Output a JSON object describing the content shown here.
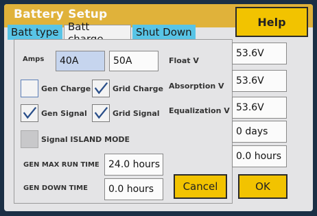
{
  "window": {
    "title": "Battery Setup",
    "help_label": "Help"
  },
  "tabs": [
    {
      "label": "Batt type",
      "active": false
    },
    {
      "label": "Batt charge",
      "active": true
    },
    {
      "label": "Shut Down",
      "active": false
    }
  ],
  "amps": {
    "label": "Amps",
    "options": [
      "40A",
      "50A"
    ],
    "selected": "40A"
  },
  "checkboxes": {
    "gen_charge": {
      "label": "Gen Charge",
      "checked": false
    },
    "grid_charge": {
      "label": "Grid Charge",
      "checked": true
    },
    "gen_signal": {
      "label": "Gen Signal",
      "checked": true
    },
    "grid_signal": {
      "label": "Grid Signal",
      "checked": true
    },
    "island_mode": {
      "label": "Signal ISLAND MODE",
      "checked": false,
      "disabled": true
    }
  },
  "gen_max_run_time": {
    "label": "GEN MAX RUN TIME",
    "value": "24.0 hours"
  },
  "gen_down_time": {
    "label": "GEN DOWN TIME",
    "value": "0.0 hours"
  },
  "voltages": {
    "float": {
      "label": "Float V",
      "value": "53.6V"
    },
    "absorption": {
      "label": "Absorption V",
      "value": "53.6V"
    },
    "equalization": {
      "label": "Equalization V",
      "value": "53.6V"
    }
  },
  "equalization_days": "0 days",
  "equalization_hours": "0.0 hours",
  "buttons": {
    "cancel_label": "Cancel",
    "ok_label": "OK"
  },
  "colors": {
    "title_bar": "#e0b23a",
    "tab": "#58c4e6",
    "button": "#f2c300",
    "selection": "#c6d5ee"
  }
}
